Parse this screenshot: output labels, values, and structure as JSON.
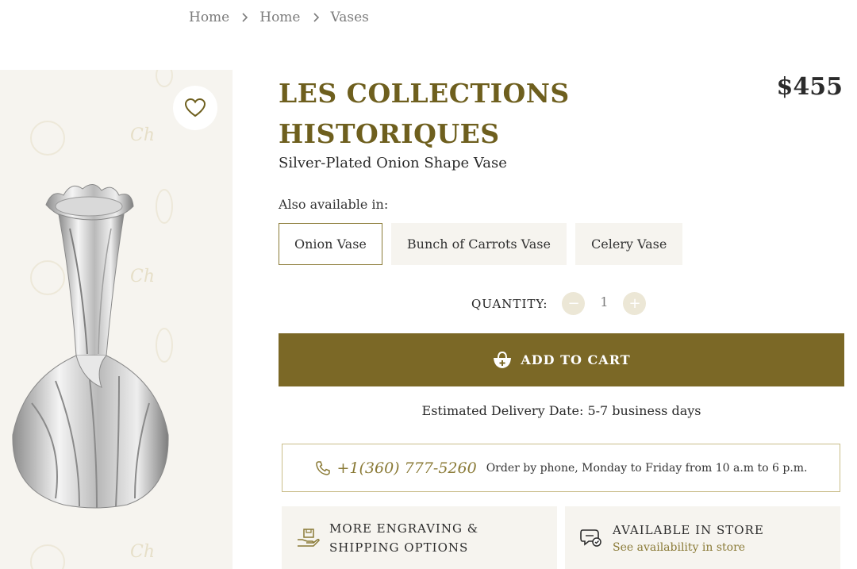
{
  "breadcrumb": {
    "items": [
      "Home",
      "Home",
      "Vases"
    ]
  },
  "product": {
    "brand": "LES COLLECTIONS HISTORIQUES",
    "price": "$455",
    "subtitle": "Silver-Plated Onion Shape Vase"
  },
  "variants": {
    "label": "Also available in:",
    "options": [
      "Onion Vase",
      "Bunch of Carrots Vase",
      "Celery Vase"
    ],
    "selected": "Onion Vase"
  },
  "quantity": {
    "label": "QUANTITY:",
    "value": "1",
    "minus": "−",
    "plus": "+"
  },
  "cart": {
    "label": "ADD TO CART"
  },
  "delivery": {
    "text": "Estimated Delivery Date: 5-7 business days"
  },
  "phone": {
    "number": "+1(360) 777-5260",
    "note": "Order by phone, Monday to Friday from 10 a.m to 6 p.m."
  },
  "info": {
    "engraving_line1": "MORE ENGRAVING &",
    "engraving_line2": "SHIPPING OPTIONS",
    "store_title": "AVAILABLE IN STORE",
    "store_link": "See availability in store"
  },
  "icons": {
    "favorite": "heart-icon",
    "breadcrumb_separator": "chevron-right-icon",
    "cart": "basket-plus-icon",
    "phone": "phone-icon",
    "engraving": "hand-box-icon",
    "store": "store-chat-icon"
  },
  "colors": {
    "brand": "#6e5f1e",
    "accent": "#7b6826",
    "gallery_bg": "#f6f4ef"
  }
}
